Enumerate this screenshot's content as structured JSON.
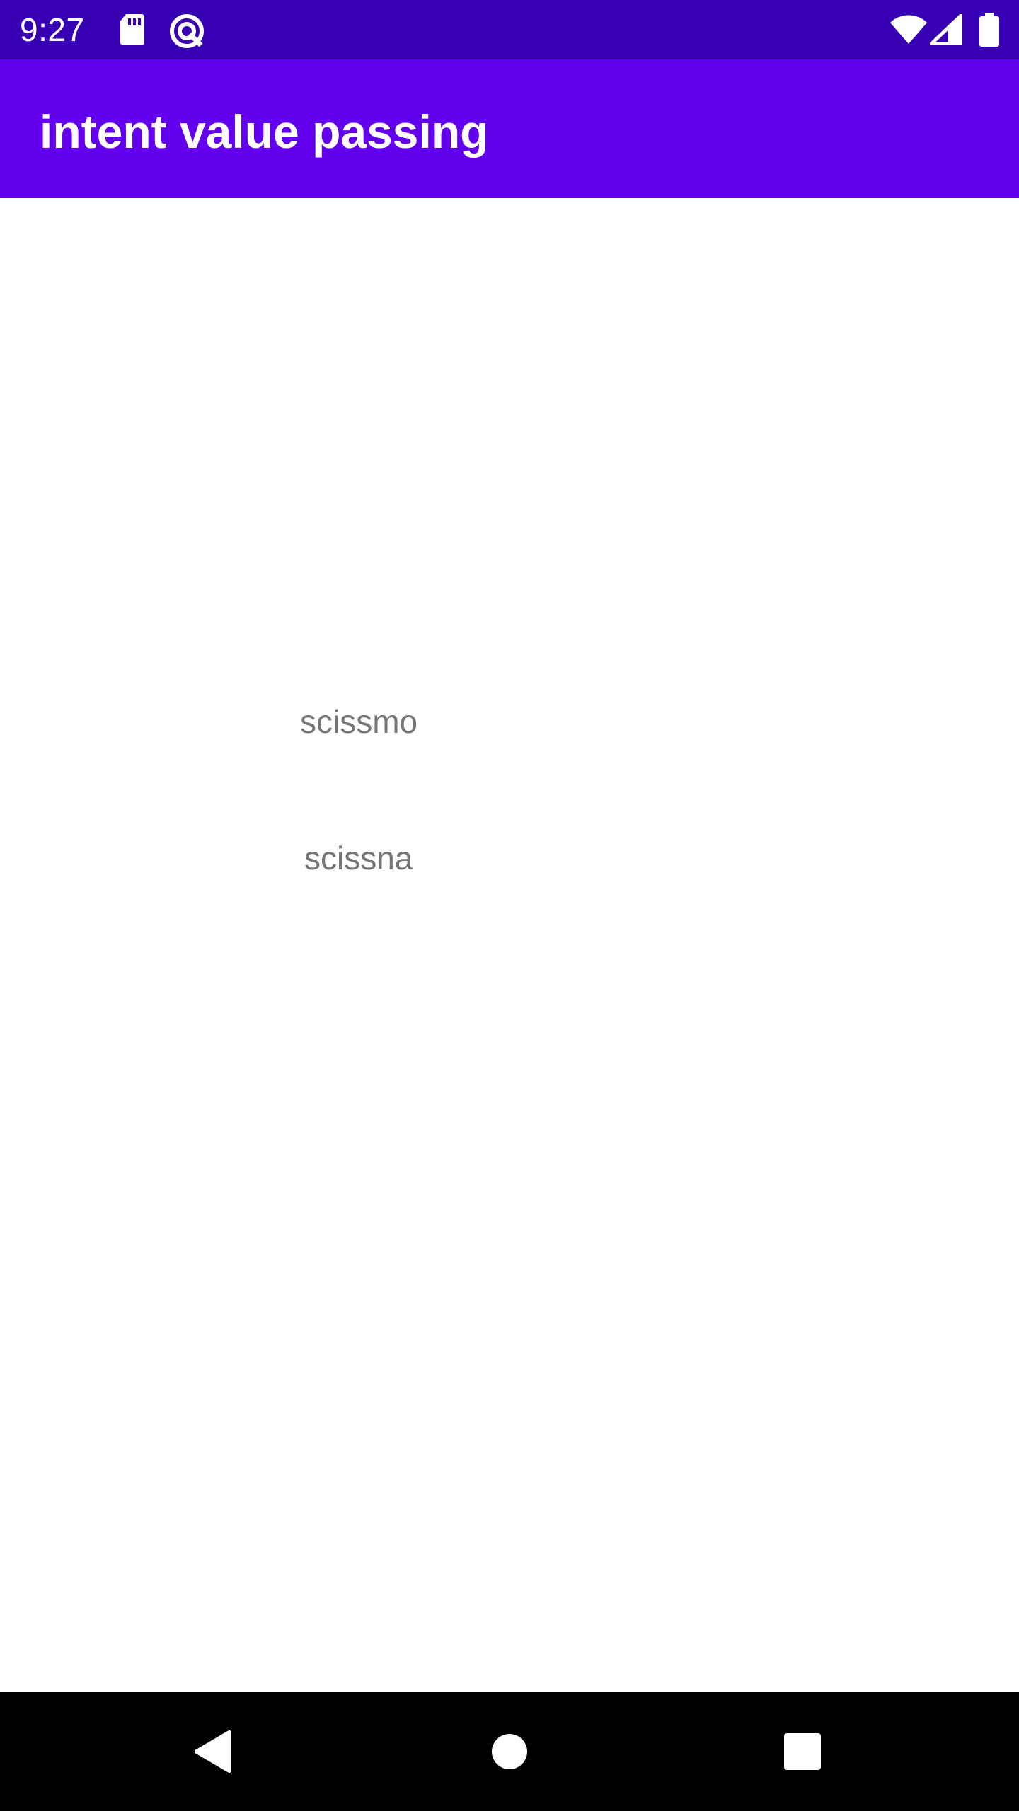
{
  "status_bar": {
    "time": "9:27",
    "background": "#3700B3",
    "left_icons": [
      "sd-card-icon",
      "data-saver-icon"
    ],
    "right_icons": [
      "wifi-icon",
      "cellular-signal-icon",
      "battery-icon"
    ]
  },
  "app_bar": {
    "title": "intent value passing",
    "background": "#6200EE"
  },
  "content": {
    "text_first": "scissmo",
    "text_second": "scissna",
    "text_color": "#757575"
  },
  "navigation_bar": {
    "buttons": [
      "back-icon",
      "home-icon",
      "recents-icon"
    ]
  }
}
